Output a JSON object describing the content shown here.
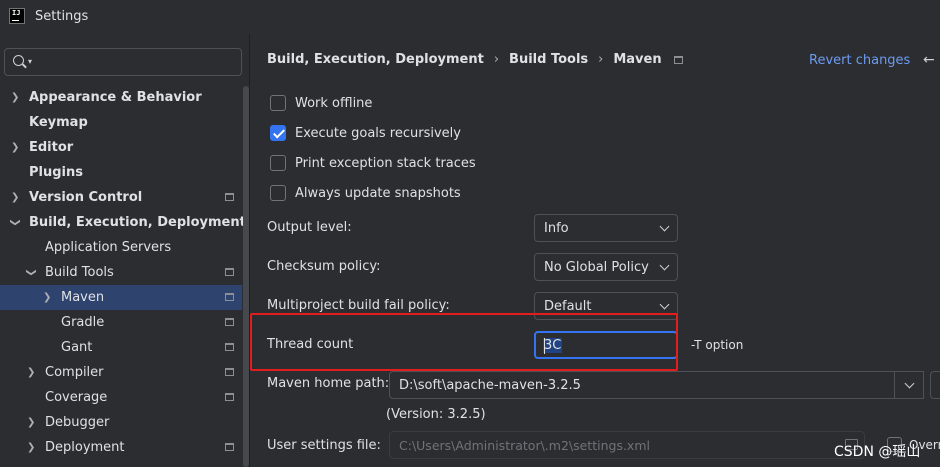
{
  "window": {
    "title": "Settings"
  },
  "sidebar": {
    "items": [
      {
        "label": "Appearance & Behavior"
      },
      {
        "label": "Keymap"
      },
      {
        "label": "Editor"
      },
      {
        "label": "Plugins"
      },
      {
        "label": "Version Control"
      },
      {
        "label": "Build, Execution, Deployment"
      },
      {
        "label": "Application Servers"
      },
      {
        "label": "Build Tools"
      },
      {
        "label": "Maven"
      },
      {
        "label": "Gradle"
      },
      {
        "label": "Gant"
      },
      {
        "label": "Compiler"
      },
      {
        "label": "Coverage"
      },
      {
        "label": "Debugger"
      },
      {
        "label": "Deployment"
      }
    ]
  },
  "header": {
    "breadcrumb": [
      "Build, Execution, Deployment",
      "Build Tools",
      "Maven"
    ],
    "revert_label": "Revert changes",
    "back_glyph": "←"
  },
  "options": {
    "work_offline": {
      "label": "Work offline",
      "checked": false
    },
    "execute_goals": {
      "label": "Execute goals recursively",
      "checked": true
    },
    "print_exception": {
      "label": "Print exception stack traces",
      "checked": false
    },
    "always_update": {
      "label": "Always update snapshots",
      "checked": false
    }
  },
  "fields": {
    "output_level": {
      "label": "Output level:",
      "value": "Info"
    },
    "checksum_policy": {
      "label": "Checksum policy:",
      "value": "No Global Policy"
    },
    "multiproject_policy": {
      "label": "Multiproject build fail policy:",
      "value": "Default"
    },
    "thread_count": {
      "label": "Thread count",
      "value": "3C",
      "hint": "-T option"
    },
    "maven_home": {
      "label": "Maven home path:",
      "value": "D:\\soft\\apache-maven-3.2.5",
      "version": "(Version: 3.2.5)"
    },
    "user_settings": {
      "label": "User settings file:",
      "value": "C:\\Users\\Administrator\\.m2\\settings.xml",
      "override_label": "Overr"
    }
  },
  "watermark": "CSDN @瑶山"
}
